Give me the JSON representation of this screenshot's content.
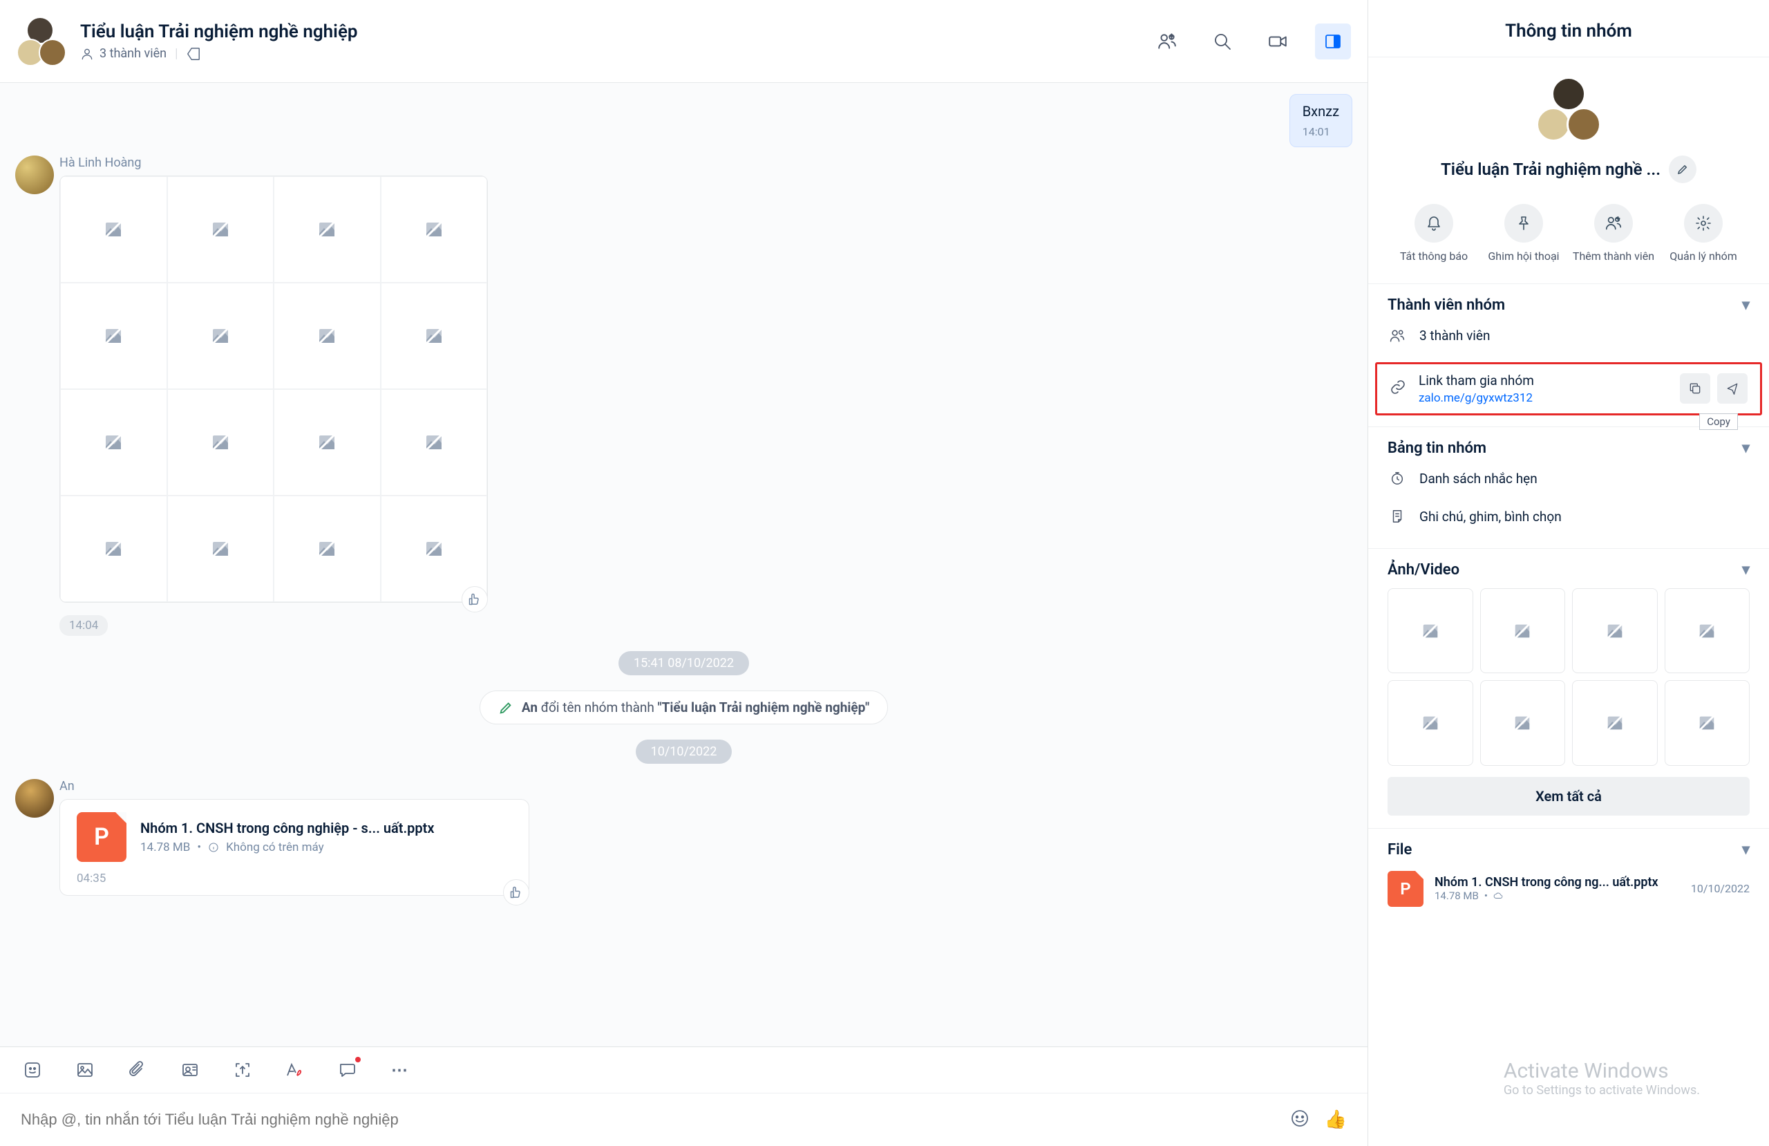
{
  "header": {
    "title": "Tiểu luận Trải nghiệm nghề nghiệp",
    "member_count": "3 thành viên"
  },
  "messages": {
    "out1": {
      "text": "Bxnzz",
      "time": "14:01"
    },
    "sender1": "Hà Linh Hoàng",
    "grid_time": "14:04",
    "divider1": "15:41 08/10/2022",
    "system1_prefix": "An",
    "system1_text": " đổi tên nhóm thành ",
    "system1_quoted": "\"Tiểu luận Trải nghiệm nghề nghiệp\"",
    "divider2": "10/10/2022",
    "sender2": "An",
    "file": {
      "name": "Nhóm 1. CNSH trong công nghiệp - s... uất.pptx",
      "size": "14.78 MB",
      "status": "Không có trên máy",
      "time": "04:35",
      "icon_letter": "P"
    }
  },
  "composer": {
    "placeholder": "Nhập @, tin nhắn tới Tiểu luận Trải nghiệm nghề nghiệp",
    "more": "⋯"
  },
  "sidebar": {
    "title": "Thông tin nhóm",
    "group_name": "Tiểu luận Trải nghiệm nghề ...",
    "quick": {
      "mute": "Tắt thông báo",
      "pin": "Ghim hội thoại",
      "add": "Thêm thành viên",
      "manage": "Quản lý nhóm"
    },
    "members": {
      "heading": "Thành viên nhóm",
      "count": "3 thành viên",
      "link_label": "Link tham gia nhóm",
      "link_url": "zalo.me/g/gyxwtz312",
      "copy_tooltip": "Copy"
    },
    "board": {
      "heading": "Bảng tin nhóm",
      "reminders": "Danh sách nhắc hẹn",
      "notes": "Ghi chú, ghim, bình chọn"
    },
    "media": {
      "heading": "Ảnh/Video",
      "see_all": "Xem tất cả"
    },
    "files": {
      "heading": "File",
      "item": {
        "name": "Nhóm 1. CNSH trong công ng... uất.pptx",
        "size": "14.78 MB",
        "date": "10/10/2022",
        "icon_letter": "P"
      }
    }
  },
  "watermark": {
    "line1": "Activate Windows",
    "line2": "Go to Settings to activate Windows."
  }
}
